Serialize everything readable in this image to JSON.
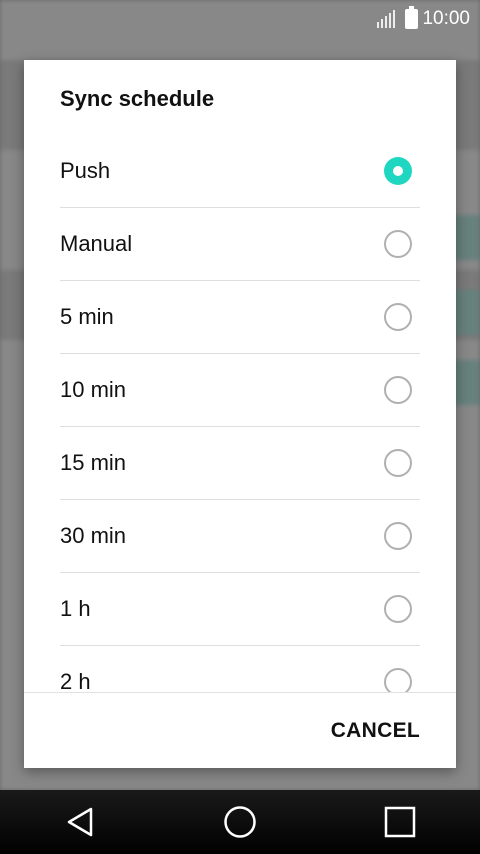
{
  "status_bar": {
    "time": "10:00"
  },
  "dialog": {
    "title": "Sync schedule",
    "selected_index": 0,
    "options": [
      {
        "label": "Push",
        "selected": true
      },
      {
        "label": "Manual",
        "selected": false
      },
      {
        "label": "5 min",
        "selected": false
      },
      {
        "label": "10 min",
        "selected": false
      },
      {
        "label": "15 min",
        "selected": false
      },
      {
        "label": "30 min",
        "selected": false
      },
      {
        "label": "1 h",
        "selected": false
      },
      {
        "label": "2 h",
        "selected": false
      }
    ],
    "cancel_label": "CANCEL"
  },
  "colors": {
    "accent": "#1fd6c1",
    "radio_border": "#b0b0b0"
  },
  "nav_bar": {
    "icons": [
      "back-icon",
      "home-icon",
      "recents-icon"
    ]
  }
}
